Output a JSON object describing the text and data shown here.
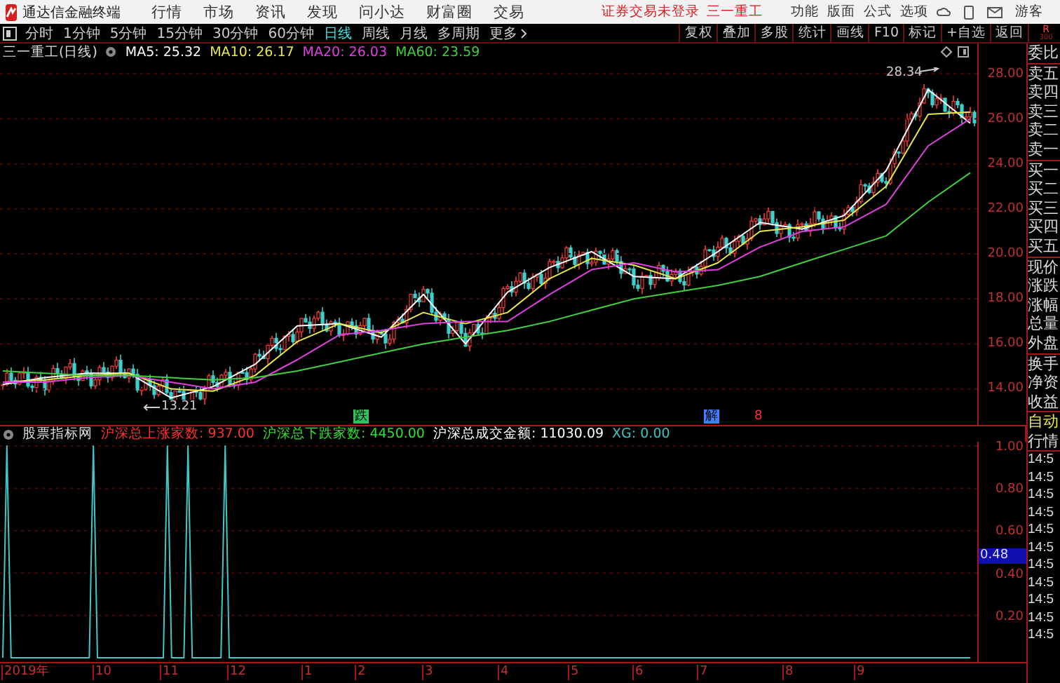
{
  "app_bar": {
    "title": "通达信金融终端",
    "menus": [
      "行情",
      "市场",
      "资讯",
      "发现",
      "问小达",
      "财富圈",
      "交易"
    ],
    "status": "证券交易未登录",
    "stock": "三一重工",
    "tools": [
      "功能",
      "版面",
      "公式",
      "选项"
    ],
    "user": "游客"
  },
  "period_tabs": [
    {
      "label": "分时",
      "selected": false
    },
    {
      "label": "1分钟",
      "selected": false
    },
    {
      "label": "5分钟",
      "selected": false
    },
    {
      "label": "15分钟",
      "selected": false
    },
    {
      "label": "30分钟",
      "selected": false
    },
    {
      "label": "60分钟",
      "selected": false
    },
    {
      "label": "日线",
      "selected": true
    },
    {
      "label": "周线",
      "selected": false
    },
    {
      "label": "月线",
      "selected": false
    },
    {
      "label": "多周期",
      "selected": false
    },
    {
      "label": "更多",
      "selected": false
    }
  ],
  "actions": [
    "复权",
    "叠加",
    "多股",
    "统计",
    "画线",
    "F10",
    "标记",
    "+自选",
    "返回"
  ],
  "corner": {
    "letter": "R",
    "code": "300"
  },
  "chart": {
    "title": "三一重工(日线)",
    "ma": [
      {
        "label": "MA5: 25.32",
        "color": "#ffffff"
      },
      {
        "label": "MA10: 26.17",
        "color": "#e8e84a"
      },
      {
        "label": "MA20: 26.03",
        "color": "#e040e0"
      },
      {
        "label": "MA60: 23.59",
        "color": "#40d040"
      }
    ],
    "high_label": "28.34",
    "low_label": "13.21",
    "markers": [
      {
        "text": "跌",
        "kind": "fall"
      },
      {
        "text": "解",
        "kind": "unlock"
      },
      {
        "text": "8",
        "kind": "number"
      }
    ],
    "chart_data": {
      "type": "line",
      "grid": true,
      "ylim": [
        12.4,
        28.6
      ],
      "yticks": [
        {
          "value": 28,
          "label": "28.00"
        },
        {
          "value": 26,
          "label": "26.00"
        },
        {
          "value": 24,
          "label": "24.00"
        },
        {
          "value": 22,
          "label": "22.00"
        },
        {
          "value": 20,
          "label": "20.00"
        },
        {
          "value": 18,
          "label": "18.00"
        },
        {
          "value": 16,
          "label": "16.00"
        },
        {
          "value": 14,
          "label": "14.00"
        }
      ],
      "series": [
        {
          "color": "#ffffff",
          "values": [
            14.2,
            14.5,
            14.7,
            14.7,
            13.6,
            14.1,
            15.1,
            16.8,
            16.9,
            16.3,
            18.2,
            16.0,
            18.3,
            19.4,
            20.1,
            19.0,
            18.9,
            20.1,
            21.4,
            21.1,
            21.7,
            23.7,
            27.3,
            25.8
          ]
        },
        {
          "color": "#e8e84a",
          "values": [
            14.3,
            14.4,
            14.6,
            14.7,
            14.0,
            13.9,
            14.6,
            16.1,
            16.9,
            16.5,
            17.4,
            16.9,
            17.4,
            18.9,
            19.8,
            19.5,
            18.9,
            19.6,
            21.0,
            21.2,
            21.5,
            23.0,
            26.2,
            26.3
          ]
        },
        {
          "color": "#e040e0",
          "values": [
            14.3,
            14.3,
            14.5,
            14.6,
            14.3,
            14.0,
            14.3,
            15.3,
            16.4,
            16.6,
            16.9,
            17.0,
            17.0,
            18.2,
            19.3,
            19.6,
            19.2,
            19.3,
            20.3,
            21.0,
            21.2,
            22.2,
            24.8,
            26.0
          ]
        },
        {
          "color": "#40d040",
          "values": [
            14.8,
            14.7,
            14.6,
            14.6,
            14.5,
            14.4,
            14.5,
            14.8,
            15.2,
            15.6,
            16.0,
            16.3,
            16.6,
            17.0,
            17.5,
            18.0,
            18.3,
            18.6,
            19.0,
            19.6,
            20.2,
            20.8,
            22.3,
            23.6
          ]
        }
      ]
    }
  },
  "indicator": {
    "name": "股票指标网",
    "values": [
      {
        "label": "沪深总上涨家数: 937.00",
        "color": "#ff3030"
      },
      {
        "label": "沪深总下跌家数: 4450.00",
        "color": "#30e030"
      },
      {
        "label": "沪深总成交金额: 11030.09",
        "color": "#ffffff"
      },
      {
        "label": "XG: 0.00",
        "color": "#40c0c0"
      }
    ],
    "cursor_value": "0.48",
    "chart_data": {
      "type": "line",
      "grid": true,
      "ylim": [
        -0.02,
        1.02
      ],
      "yticks": [
        {
          "value": 1,
          "label": "1.00"
        },
        {
          "value": 0.8,
          "label": "0.80"
        },
        {
          "value": 0.6,
          "label": "0.60"
        },
        {
          "value": 0.4,
          "label": "0.40"
        },
        {
          "value": 0.2,
          "label": "0.20"
        }
      ],
      "series": [
        {
          "color": "#40c8c8",
          "values": [
            0,
            1,
            0,
            0,
            0,
            0,
            0,
            0,
            0,
            0,
            0,
            0,
            0,
            0,
            0,
            0,
            0,
            0,
            0,
            0,
            0,
            0,
            1,
            0,
            0,
            0,
            0,
            0,
            0,
            0,
            0,
            0,
            0,
            0,
            0,
            0,
            0,
            0,
            0,
            0,
            1,
            0,
            0,
            0,
            0,
            1,
            0,
            0,
            0,
            0,
            0,
            0,
            0,
            0,
            1,
            0,
            0,
            0,
            0,
            0,
            0,
            0,
            0,
            0,
            0,
            0,
            0,
            0,
            0,
            0,
            0,
            0,
            0,
            0,
            0,
            0,
            0,
            0,
            0,
            0,
            0,
            0,
            0,
            0,
            0,
            0,
            0,
            0,
            0,
            0,
            0,
            0,
            0,
            0,
            0,
            0,
            0,
            0,
            0,
            0,
            0,
            0,
            0,
            0,
            0,
            0,
            0,
            0,
            0,
            0,
            0,
            0,
            0,
            0,
            0,
            0,
            0,
            0,
            0,
            0,
            0,
            0,
            0,
            0,
            0,
            0,
            0,
            0,
            0,
            0,
            0,
            0,
            0,
            0,
            0,
            0,
            0,
            0,
            0,
            0,
            0,
            0,
            0,
            0,
            0,
            0,
            0,
            0,
            0,
            0,
            0,
            0,
            0,
            0,
            0,
            0,
            0,
            0,
            0,
            0,
            0,
            0,
            0,
            0,
            0,
            0,
            0,
            0,
            0,
            0,
            0,
            0,
            0,
            0,
            0,
            0,
            0,
            0,
            0,
            0,
            0,
            0,
            0,
            0,
            0,
            0,
            0,
            0,
            0,
            0,
            0,
            0,
            0,
            0,
            0,
            0,
            0,
            0,
            0,
            0,
            0,
            0,
            0,
            0,
            0,
            0,
            0,
            0,
            0,
            0,
            0,
            0,
            0,
            0,
            0,
            0,
            0,
            0,
            0,
            0,
            0,
            0,
            0,
            0,
            0,
            0,
            0,
            0,
            0,
            0,
            0,
            0,
            0,
            0,
            0,
            0
          ]
        }
      ]
    }
  },
  "x_axis": [
    "2019年",
    "10",
    "11",
    "12",
    "1",
    "2",
    "3",
    "4",
    "5",
    "6",
    "7",
    "8",
    "9"
  ],
  "side_panel": {
    "groups": [
      [
        "委比"
      ],
      [
        "卖五",
        "卖四",
        "卖三",
        "卖二",
        "卖一"
      ],
      [
        "买一",
        "买二",
        "买三",
        "买四",
        "买五"
      ],
      [
        "现价",
        "涨跌",
        "涨幅",
        "总量",
        "外盘"
      ],
      [
        "换手",
        "净资",
        "收益"
      ]
    ],
    "mode": [
      "自动",
      "行情"
    ],
    "times": [
      "14:5",
      "14:5",
      "14:5",
      "14:5",
      "14:5",
      "14:5",
      "14:5",
      "14:5",
      "14:5",
      "14:5",
      "14:5"
    ]
  }
}
